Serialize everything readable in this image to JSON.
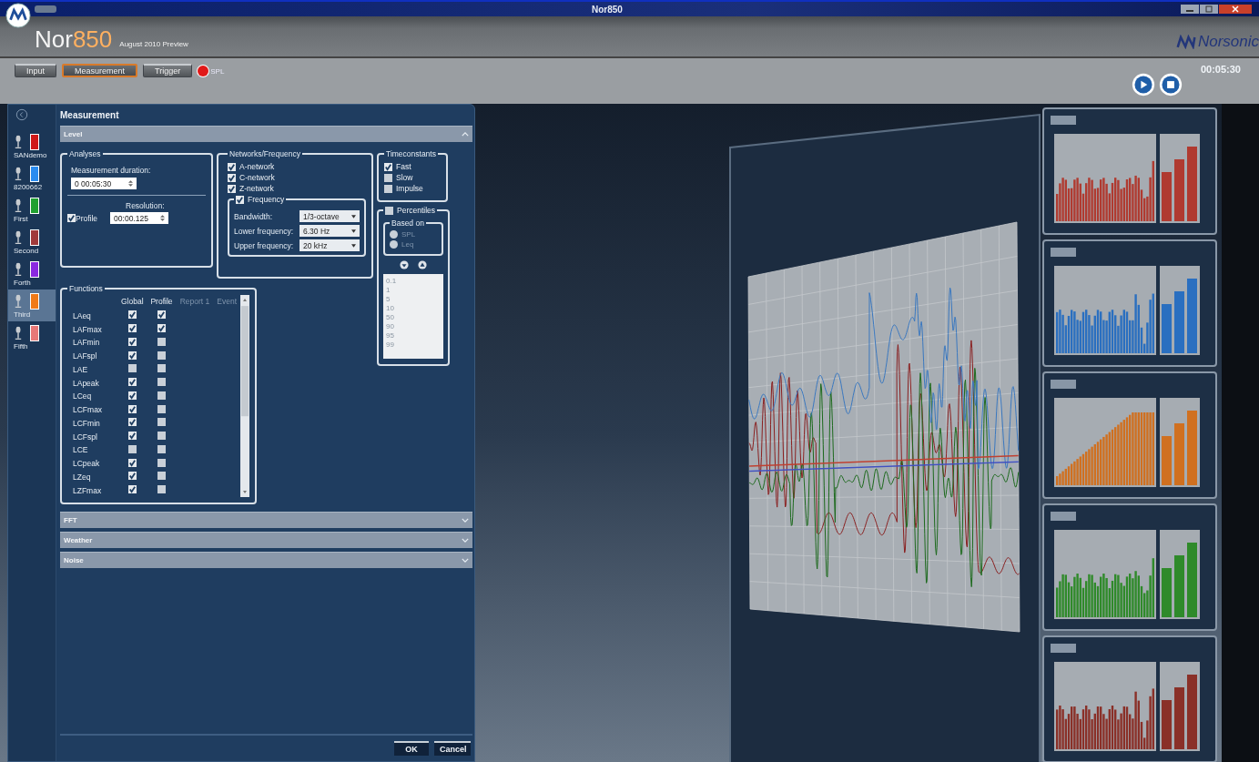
{
  "window": {
    "title": "Nor850"
  },
  "header": {
    "brand": "Nor",
    "brand_accent": "850",
    "subtitle": "August 2010 Preview",
    "company": "Norsonic"
  },
  "tabs": [
    {
      "label": "Input",
      "selected": false
    },
    {
      "label": "Measurement",
      "selected": true
    },
    {
      "label": "Trigger",
      "selected": false
    }
  ],
  "spl_indicator": {
    "label": "SPL",
    "on": true
  },
  "transport": {
    "time": "00:05:30"
  },
  "channels": [
    {
      "name": "SANdemo",
      "color": "#d01818",
      "selected": false
    },
    {
      "name": "8200662",
      "color": "#2a8cf0",
      "selected": false
    },
    {
      "name": "First",
      "color": "#20a030",
      "selected": false
    },
    {
      "name": "Second",
      "color": "#a03a3a",
      "selected": false
    },
    {
      "name": "Forth",
      "color": "#8a28e0",
      "selected": false
    },
    {
      "name": "Third",
      "color": "#f07a18",
      "selected": true
    },
    {
      "name": "Fifth",
      "color": "#e87878",
      "selected": false
    }
  ],
  "panel": {
    "title": "Measurement",
    "sections": [
      {
        "label": "Level",
        "expanded": true
      },
      {
        "label": "FFT",
        "expanded": false
      },
      {
        "label": "Weather",
        "expanded": false
      },
      {
        "label": "Noise",
        "expanded": false
      }
    ]
  },
  "analyses": {
    "title": "Analyses",
    "duration_label": "Measurement duration:",
    "duration": "0 00:05:30",
    "profile": {
      "label": "Profile",
      "checked": true
    },
    "resolution_label": "Resolution:",
    "resolution": "00:00.125"
  },
  "networks": {
    "title": "Networks/Frequency",
    "items": [
      {
        "label": "A-network",
        "checked": true
      },
      {
        "label": "C-network",
        "checked": true
      },
      {
        "label": "Z-network",
        "checked": true
      }
    ],
    "frequency": {
      "label": "Frequency",
      "checked": true,
      "fields": [
        {
          "label": "Bandwidth:",
          "value": "1/3-octave"
        },
        {
          "label": "Lower frequency:",
          "value": "6.30 Hz"
        },
        {
          "label": "Upper frequency:",
          "value": "20 kHz"
        }
      ]
    }
  },
  "timeconstants": {
    "title": "Timeconstants",
    "items": [
      {
        "label": "Fast",
        "checked": true
      },
      {
        "label": "Slow",
        "checked": false
      },
      {
        "label": "Impulse",
        "checked": false
      }
    ]
  },
  "percentiles": {
    "label": "Percentiles",
    "checked": false,
    "based_on": {
      "title": "Based on",
      "options": [
        {
          "label": "SPL",
          "selected": false
        },
        {
          "label": "Leq",
          "selected": false
        }
      ]
    },
    "values": [
      "0.1",
      "1",
      "5",
      "10",
      "50",
      "90",
      "95",
      "99"
    ]
  },
  "functions": {
    "title": "Functions",
    "columns": [
      {
        "label": "Global",
        "disabled": false
      },
      {
        "label": "Profile",
        "disabled": false
      },
      {
        "label": "Report 1",
        "disabled": true
      },
      {
        "label": "Event",
        "disabled": true
      }
    ],
    "rows": [
      {
        "name": "LAeq",
        "global": true,
        "profile": true
      },
      {
        "name": "LAFmax",
        "global": true,
        "profile": true
      },
      {
        "name": "LAFmin",
        "global": true,
        "profile": false
      },
      {
        "name": "LAFspl",
        "global": true,
        "profile": false
      },
      {
        "name": "LAE",
        "global": false,
        "profile": false
      },
      {
        "name": "LApeak",
        "global": true,
        "profile": false
      },
      {
        "name": "LCeq",
        "global": true,
        "profile": false
      },
      {
        "name": "LCFmax",
        "global": true,
        "profile": false
      },
      {
        "name": "LCFmin",
        "global": true,
        "profile": false
      },
      {
        "name": "LCFspl",
        "global": true,
        "profile": false
      },
      {
        "name": "LCE",
        "global": false,
        "profile": false
      },
      {
        "name": "LCpeak",
        "global": true,
        "profile": false
      },
      {
        "name": "LZeq",
        "global": true,
        "profile": false
      },
      {
        "name": "LZFmax",
        "global": true,
        "profile": false
      }
    ]
  },
  "buttons": [
    {
      "label": "OK"
    },
    {
      "label": "Cancel"
    }
  ]
}
